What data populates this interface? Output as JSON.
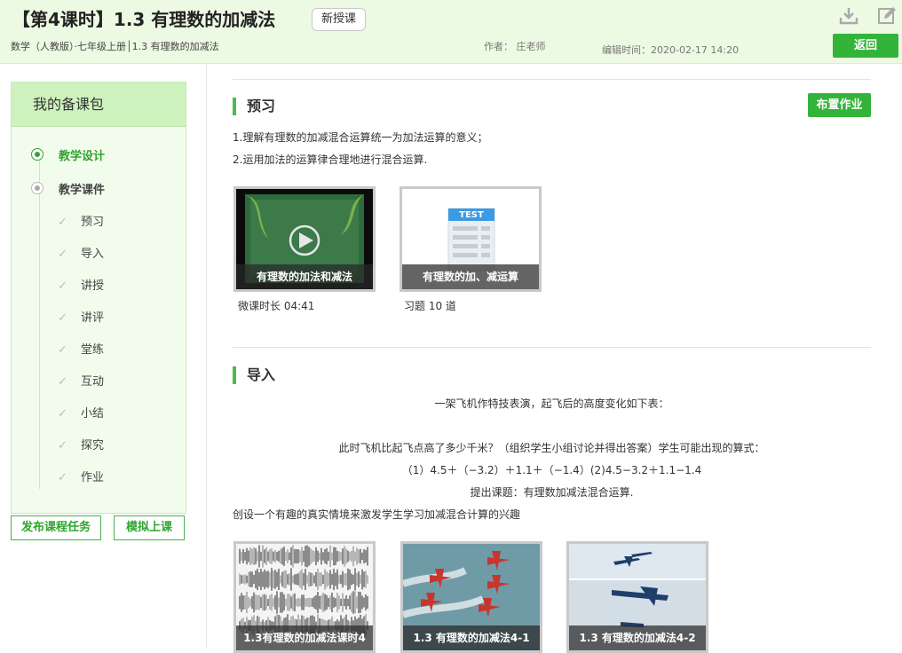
{
  "header": {
    "title": "【第4课时】1.3 有理数的加减法",
    "badge": "新授课",
    "breadcrumb": "数学（人教版）·七年级上册│1.3 有理数的加减法",
    "author": "作者：  庄老师",
    "edit_time": "编辑时间：2020-02-17 14:20",
    "back_label": "返回"
  },
  "sidebar": {
    "title": "我的备课包",
    "sections": [
      {
        "label": "教学设计",
        "active": true
      },
      {
        "label": "教学课件",
        "active": false
      }
    ],
    "items": [
      "预习",
      "导入",
      "讲授",
      "讲评",
      "堂练",
      "互动",
      "小结",
      "探究",
      "作业"
    ],
    "publish_label": "发布课程任务",
    "simulate_label": "模拟上课"
  },
  "preview": {
    "title": "预习",
    "assign_label": "布置作业",
    "lines": [
      "1.理解有理数的加减混合运算统一为加法运算的意义；",
      "2.运用加法的运算律合理地进行混合运算."
    ],
    "cards": [
      {
        "caption": "有理数的加法和减法",
        "meta": "微课时长 04:41"
      },
      {
        "caption": "有理数的加、减运算",
        "meta": "习题 10 道",
        "test_label": "TEST"
      }
    ]
  },
  "intro": {
    "title": "导入",
    "line1": "一架飞机作特技表演，起飞后的高度变化如下表：",
    "line2": "此时飞机比起飞点高了多少千米？（组织学生小组讨论并得出答案）学生可能出现的算式：",
    "line3": "（1）4.5＋（−3.2）＋1.1＋（−1.4）(2)4.5−3.2＋1.1−1.4",
    "line4": "提出课题：有理数加减法混合运算.",
    "line5": "创设一个有趣的真实情境来激发学生学习加减混合计算的兴趣",
    "cards": [
      {
        "caption": "1.3有理数的加减法课时4"
      },
      {
        "caption": "1.3 有理数的加减法4-1"
      },
      {
        "caption": "1.3 有理数的加减法4-2"
      }
    ]
  },
  "colors": {
    "accent": "#34b33b",
    "header_bg": "#ecf9e3",
    "sidebar_bg": "#f2fced"
  }
}
